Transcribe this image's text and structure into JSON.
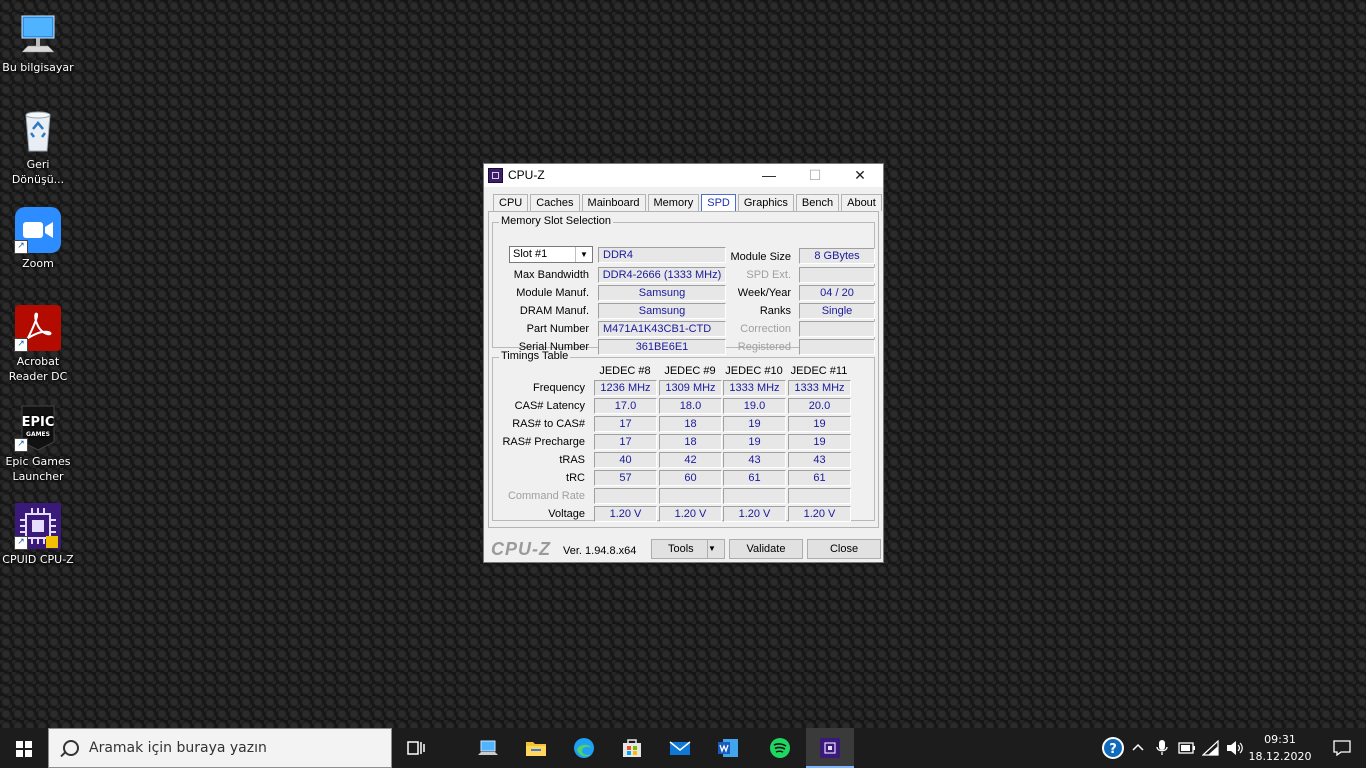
{
  "desktop": {
    "icons": [
      {
        "label": "Bu bilgisayar"
      },
      {
        "label": "Geri Dönüşü..."
      },
      {
        "label": "Zoom"
      },
      {
        "label": "Acrobat Reader DC"
      },
      {
        "label": "Epic Games Launcher"
      },
      {
        "label": "CPUID CPU-Z"
      }
    ],
    "epic_logo_text": "EPIC",
    "epic_logo_sub": "GAMES"
  },
  "window": {
    "title": "CPU-Z",
    "controls": {
      "minimize": "—",
      "maximize": "☐",
      "close": "✕"
    },
    "tabs": [
      "CPU",
      "Caches",
      "Mainboard",
      "Memory",
      "SPD",
      "Graphics",
      "Bench",
      "About"
    ],
    "active_tab": "SPD",
    "memory_slot": {
      "legend": "Memory Slot Selection",
      "slot_selected": "Slot #1",
      "type": "DDR4",
      "labels": {
        "max_bandwidth": "Max Bandwidth",
        "module_manuf": "Module Manuf.",
        "dram_manuf": "DRAM Manuf.",
        "part_number": "Part Number",
        "serial_number": "Serial Number",
        "module_size": "Module Size",
        "spd_ext": "SPD Ext.",
        "week_year": "Week/Year",
        "ranks": "Ranks",
        "correction": "Correction",
        "registered": "Registered"
      },
      "values": {
        "max_bandwidth": "DDR4-2666 (1333 MHz)",
        "module_manuf": "Samsung",
        "dram_manuf": "Samsung",
        "part_number": "M471A1K43CB1-CTD",
        "serial_number": "361BE6E1",
        "module_size": "8 GBytes",
        "spd_ext": "",
        "week_year": "04 / 20",
        "ranks": "Single",
        "correction": "",
        "registered": ""
      }
    },
    "timings": {
      "legend": "Timings Table",
      "columns": [
        "JEDEC #8",
        "JEDEC #9",
        "JEDEC #10",
        "JEDEC #11"
      ],
      "rows": [
        {
          "label": "Frequency",
          "values": [
            "1236 MHz",
            "1309 MHz",
            "1333 MHz",
            "1333 MHz"
          ]
        },
        {
          "label": "CAS# Latency",
          "values": [
            "17.0",
            "18.0",
            "19.0",
            "20.0"
          ]
        },
        {
          "label": "RAS# to CAS#",
          "values": [
            "17",
            "18",
            "19",
            "19"
          ]
        },
        {
          "label": "RAS# Precharge",
          "values": [
            "17",
            "18",
            "19",
            "19"
          ]
        },
        {
          "label": "tRAS",
          "values": [
            "40",
            "42",
            "43",
            "43"
          ]
        },
        {
          "label": "tRC",
          "values": [
            "57",
            "60",
            "61",
            "61"
          ]
        },
        {
          "label": "Command Rate",
          "values": [
            "",
            "",
            "",
            ""
          ]
        },
        {
          "label": "Voltage",
          "values": [
            "1.20 V",
            "1.20 V",
            "1.20 V",
            "1.20 V"
          ]
        }
      ]
    },
    "footer": {
      "brand": "CPU-Z",
      "version": "Ver. 1.94.8.x64",
      "tools_label": "Tools",
      "validate_label": "Validate",
      "close_label": "Close"
    }
  },
  "taskbar": {
    "search_placeholder": "Aramak için buraya yazın",
    "clock_time": "09:31",
    "clock_date": "18.12.2020"
  }
}
